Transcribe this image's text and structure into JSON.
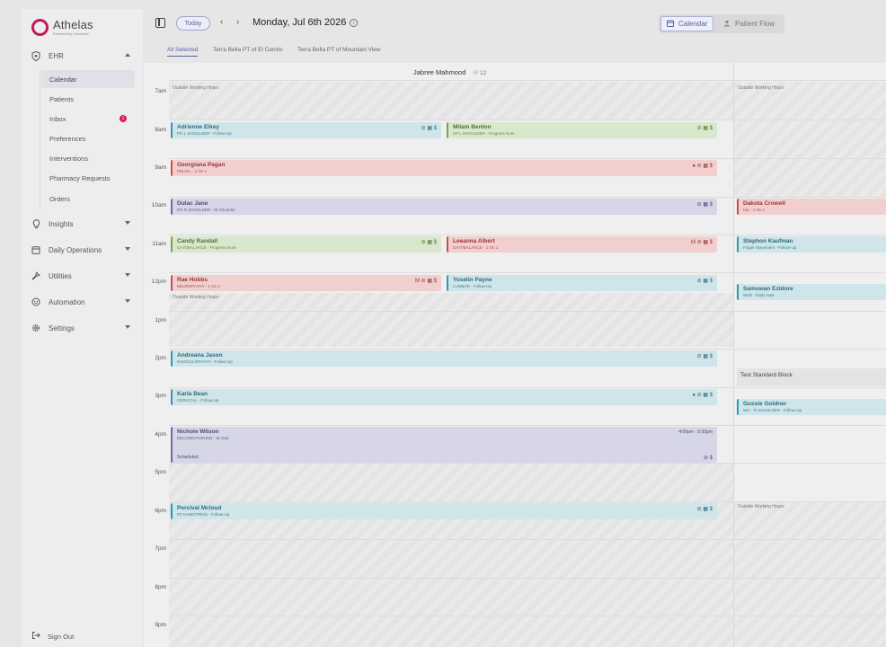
{
  "brand": {
    "name": "Athelas",
    "tagline": "Powered by Commure"
  },
  "sidebar": {
    "ehr_label": "EHR",
    "sub_items": [
      {
        "label": "Calendar",
        "active": true
      },
      {
        "label": "Patients"
      },
      {
        "label": "Inbox",
        "badge": "1"
      },
      {
        "label": "Preferences"
      },
      {
        "label": "Interventions"
      },
      {
        "label": "Pharmacy Requests"
      },
      {
        "label": "Orders"
      }
    ],
    "sections": [
      {
        "label": "Insights",
        "icon": "lightbulb-icon"
      },
      {
        "label": "Daily Operations",
        "icon": "calendar-icon"
      },
      {
        "label": "Utilities",
        "icon": "wrench-icon"
      },
      {
        "label": "Automation",
        "icon": "robot-icon"
      },
      {
        "label": "Settings",
        "icon": "gear-icon"
      }
    ],
    "sign_out": "Sign Out"
  },
  "topbar": {
    "today": "Today",
    "date_title": "Monday, Jul 6th 2026",
    "views": [
      {
        "label": "Calendar",
        "active": true
      },
      {
        "label": "Patient Flow"
      }
    ]
  },
  "locations": [
    "All Selected",
    "Terra Bella PT of El Cerrito",
    "Terra Bella PT of Mountain View"
  ],
  "calendar": {
    "provider": {
      "name": "Jabree Mahmood",
      "count": "12"
    },
    "hours": [
      "7am",
      "8am",
      "9am",
      "10am",
      "11am",
      "12pm",
      "1pm",
      "2pm",
      "3pm",
      "4pm",
      "5pm",
      "6pm",
      "7pm",
      "8pm",
      "9pm"
    ],
    "outside_label": "Outside Working Hours",
    "block_label": "Test Standard Block",
    "appointments": [
      {
        "name": "Adrienne Eikey",
        "desc": "PO L SHOULDER - Follow-Up",
        "color": "blue",
        "icons": "⊘ ▦ $"
      },
      {
        "name": "Milam Benton",
        "desc": "SP L SHOULDER - Progress Note",
        "color": "green",
        "icons": "⊘ ▦ $"
      },
      {
        "name": "Georgiana Pagan",
        "desc": "PELVIC - 1 On 1",
        "color": "red",
        "icons": "● ⊘ ▦ $"
      },
      {
        "name": "Dulac Jane",
        "desc": "PO R SHOULDER - IE Shoulder",
        "color": "purple",
        "icons": "⊘ ▦ $"
      },
      {
        "name": "Candy Randall",
        "desc": "GAIT/BALANCE - Progress Note",
        "color": "green",
        "icons": "⊘ ▦ $"
      },
      {
        "name": "Leeanna Albert",
        "desc": "GAIT/BALANCE - 1 On 1",
        "color": "red",
        "icons": "M ⊘ ▦ $"
      },
      {
        "name": "Rae Hobbs",
        "desc": "NEUROPATHY - 1 On 1",
        "color": "red",
        "icons": "M ⊘ ▦ $"
      },
      {
        "name": "Yoselin Payne",
        "desc": "LUMBAR - Follow-Up",
        "color": "blue",
        "icons": "⊘ ▦ $"
      },
      {
        "name": "Andreana Jason",
        "desc": "RADICULOPATHY - Follow-Up",
        "color": "blue",
        "icons": "⊘ ▦ $"
      },
      {
        "name": "Karla Bean",
        "desc": "CERVICAL - Follow-Up",
        "color": "blue",
        "icons": "● ⊘ ▦ $"
      },
      {
        "name": "Nichole Wilson",
        "desc": "DECONDITIONING - IE Gait",
        "color": "purple",
        "time": "4:00pm - 5:00pm",
        "status": "Scheduled",
        "icons": "⊘ $"
      },
      {
        "name": "Percival Mcloud",
        "desc": "RT HAMSTRING - Follow-Up",
        "color": "blue",
        "icons": "⊘ ▦ $"
      },
      {
        "name": "Dakota Crowell",
        "desc": "Hip - 1 On 1",
        "color": "red"
      },
      {
        "name": "Stephon Kaufman",
        "desc": "Finger Movement - Follow-Up",
        "color": "blue"
      },
      {
        "name": "Samuwan Ezidore",
        "desc": "Wrist - Daily Note",
        "color": "blue"
      },
      {
        "name": "Gussie Goldner",
        "desc": "WC - R SHOULDER - Follow-Up",
        "color": "blue"
      }
    ]
  }
}
